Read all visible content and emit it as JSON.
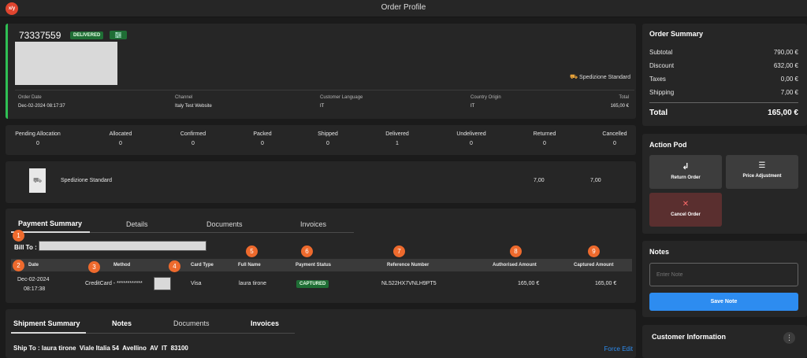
{
  "app": {
    "logo_text": "x/y",
    "title": "Order Profile"
  },
  "order": {
    "number": "73337559",
    "status": "DELIVERED",
    "shipping_method": "Spedizione Standard",
    "fields": [
      {
        "label": "Order Date",
        "value": "Dec-02-2024 08:17:37"
      },
      {
        "label": "Channel",
        "value": "Italy Test Website"
      },
      {
        "label": "Customer Language",
        "value": "IT"
      },
      {
        "label": "Country Origin",
        "value": "IT"
      },
      {
        "label": "Total",
        "value": "165,00 €"
      }
    ]
  },
  "counts": [
    {
      "label": "Pending Allocation",
      "value": "0"
    },
    {
      "label": "Allocated",
      "value": "0"
    },
    {
      "label": "Confirmed",
      "value": "0"
    },
    {
      "label": "Packed",
      "value": "0"
    },
    {
      "label": "Shipped",
      "value": "0"
    },
    {
      "label": "Delivered",
      "value": "1"
    },
    {
      "label": "Undelivered",
      "value": "0"
    },
    {
      "label": "Returned",
      "value": "0"
    },
    {
      "label": "Cancelled",
      "value": "0"
    }
  ],
  "line_item": {
    "name": "Spedizione Standard",
    "price1": "7,00",
    "price2": "7,00"
  },
  "payment": {
    "tabs": [
      "Payment Summary",
      "Details",
      "Documents",
      "Invoices"
    ],
    "bill_to_label": "Bill To :",
    "columns": [
      "Date",
      "Method",
      "Card Type",
      "Full Name",
      "Payment Status",
      "Reference Number",
      "Authorised Amount",
      "Captured Amount"
    ],
    "markers": [
      "1",
      "2",
      "3",
      "4",
      "5",
      "6",
      "7",
      "8",
      "9"
    ],
    "row": {
      "date": "Dec-02-2024",
      "time": "08:17:38",
      "method": "CreditCard - ************",
      "card_type": "Visa",
      "full_name": "laura tirone",
      "status": "CAPTURED",
      "reference": "NL522HX7VNLH9PT5",
      "authorised": "165,00 €",
      "captured": "165,00 €"
    }
  },
  "shipment": {
    "tabs": [
      "Shipment Summary",
      "Notes",
      "Documents",
      "Invoices"
    ],
    "ship_to": "Ship To : laura tirone  Viale Italia 54  Avellino  AV  IT  83100",
    "force_edit": "Force Edit"
  },
  "order_summary": {
    "title": "Order Summary",
    "rows": [
      {
        "label": "Subtotal",
        "value": "790,00 €"
      },
      {
        "label": "Discount",
        "value": "632,00 €"
      },
      {
        "label": "Taxes",
        "value": "0,00 €"
      },
      {
        "label": "Shipping",
        "value": "7,00 €"
      }
    ],
    "total_label": "Total",
    "total_value": "165,00 €"
  },
  "action_pod": {
    "title": "Action Pod",
    "return_label": "Return Order",
    "price_label": "Price Adjustment",
    "cancel_label": "Cancel Order"
  },
  "notes": {
    "title": "Notes",
    "placeholder": "Enter Note",
    "save_label": "Save Note"
  },
  "customer": {
    "title": "Customer Information"
  },
  "colors": {
    "accent_blue": "#2d8cf0",
    "delivered_green": "#1f6e35",
    "marker_orange": "#ee6a2d",
    "cancel_red": "#5a2f2f",
    "status_stripe": "#2fbf54"
  }
}
